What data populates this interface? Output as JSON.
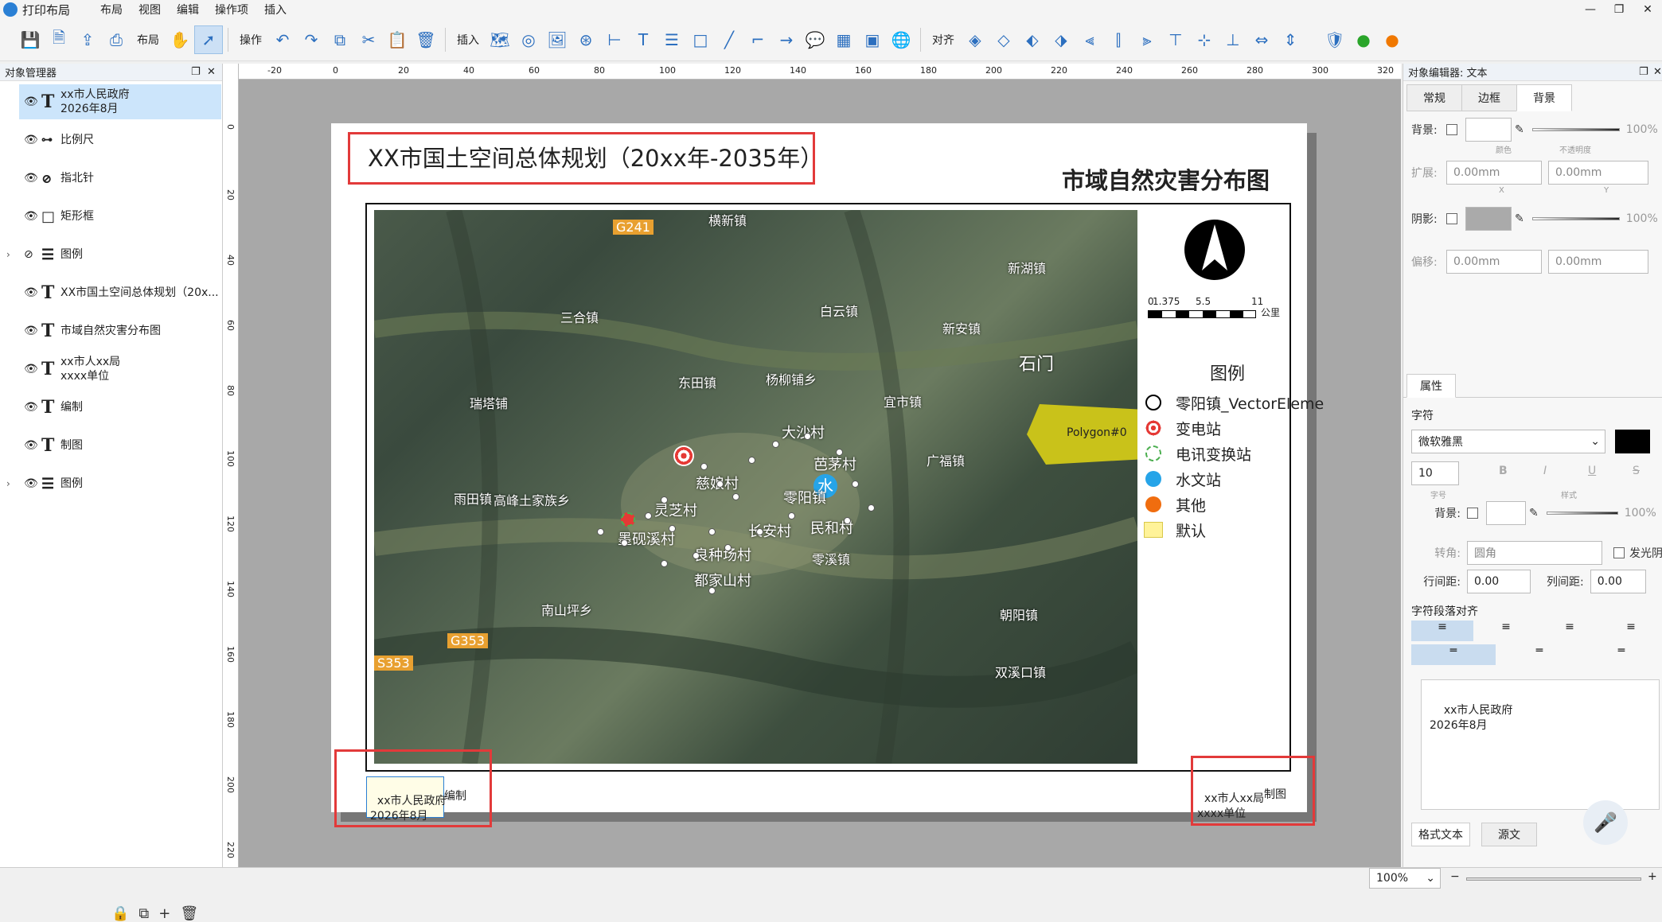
{
  "app": {
    "title": "打印布局",
    "menu": [
      "布局",
      "视图",
      "编辑",
      "操作项",
      "插入"
    ],
    "window_controls": [
      "—",
      "❐",
      "✕"
    ]
  },
  "toolbar": {
    "layout_label": "布局",
    "operate_label": "操作",
    "insert_label": "插入",
    "align_label": "对齐"
  },
  "object_manager": {
    "title": "对象管理器",
    "items": [
      {
        "icon": "text-icon",
        "label": "xx市人民政府\n2026年8月",
        "selected": true
      },
      {
        "icon": "scale-bar-icon",
        "label": "比例尺"
      },
      {
        "icon": "compass-icon",
        "label": "指北针"
      },
      {
        "icon": "rectangle-icon",
        "label": "矩形框"
      },
      {
        "icon": "legend-icon",
        "label": "图例",
        "expandable": true,
        "hidden": true
      },
      {
        "icon": "text-icon",
        "label": "XX市国土空间总体规划（20x..."
      },
      {
        "icon": "text-icon",
        "label": "市域自然灾害分布图"
      },
      {
        "icon": "text-icon",
        "label": "xx市人xx局\nxxxx单位"
      },
      {
        "icon": "text-icon",
        "label": "编制"
      },
      {
        "icon": "text-icon",
        "label": "制图"
      },
      {
        "icon": "legend-icon",
        "label": "图例",
        "expandable": true
      }
    ]
  },
  "ruler": {
    "h_ticks": [
      "-20",
      "0",
      "20",
      "40",
      "60",
      "80",
      "100",
      "120",
      "140",
      "160",
      "180",
      "200",
      "220",
      "240",
      "260",
      "280",
      "300",
      "320"
    ],
    "v_ticks": [
      "0",
      "20",
      "40",
      "60",
      "80",
      "100",
      "120",
      "140",
      "160",
      "180",
      "200",
      "220"
    ]
  },
  "layout_page": {
    "main_title": "XX市国土空间总体规划（20xx年-2035年）",
    "subtitle": "市域自然灾害分布图",
    "scale_labels": [
      "0",
      "1.375",
      "5.5",
      "11",
      "公里"
    ],
    "legend": {
      "title": "图例",
      "items": [
        {
          "symbol": "circle-outline",
          "label": "零阳镇_VectorEleme"
        },
        {
          "symbol": "target",
          "label": "变电站"
        },
        {
          "symbol": "telecom",
          "label": "电讯变换站"
        },
        {
          "symbol": "water",
          "label": "水文站"
        },
        {
          "symbol": "orange-dot",
          "label": "其他"
        },
        {
          "symbol": "yellow-rect",
          "label": "默认"
        }
      ]
    },
    "footer_left": "xx市人民政府\n2026年8月",
    "footer_left_tail": "编制",
    "footer_right": "xx市人xx局\nxxxx单位",
    "footer_right_tail": "制图",
    "map_labels": [
      "G241",
      "横新镇",
      "三合镇",
      "白云镇",
      "新湖镇",
      "新安镇",
      "石门",
      "东田镇",
      "杨柳铺乡",
      "大沙村",
      "芭茅村",
      "广福镇",
      "水",
      "零阳镇",
      "灵芝村",
      "墨砚溪村",
      "良种场村",
      "都家山村",
      "雨田镇",
      "G353",
      "S353",
      "南山坪乡",
      "零溪镇",
      "双溪口镇",
      "Polygon#0",
      "宜市镇",
      "长安村",
      "民和村",
      "慈娘村",
      "高峰土家族乡",
      "瑞塔铺",
      "朝阳镇"
    ]
  },
  "object_editor": {
    "title": "对象编辑器: 文本",
    "tabs": [
      "常规",
      "边框",
      "背景"
    ],
    "active_tab": "背景",
    "background_label": "背景:",
    "background_opacity": "100%",
    "color_caption": "颜色",
    "opacity_caption": "不透明度",
    "expand_label": "扩展:",
    "expand_x": "0.00mm",
    "expand_y": "0.00mm",
    "shadow_label": "阴影:",
    "shadow_opacity": "100%",
    "offset_label": "偏移:",
    "offset_x": "0.00mm",
    "offset_y": "0.00mm",
    "axis_x": "X",
    "axis_y": "Y"
  },
  "properties": {
    "tab": "属性",
    "char_label": "字符",
    "font": "微软雅黑",
    "size": "10",
    "size_caption": "字号",
    "style_caption": "样式",
    "bg_label": "背景:",
    "bg_opacity": "100%",
    "corner_label": "转角:",
    "corner_value": "圆角",
    "glow_label": "发光阴影",
    "line_spacing_label": "行间距:",
    "line_spacing": "0.00",
    "col_spacing_label": "列间距:",
    "col_spacing": "0.00",
    "align_label": "字符段落对齐",
    "text_content": "xx市人民政府\n2026年8月",
    "rich_text_tab": "格式文本",
    "source_tab": "源文"
  },
  "status": {
    "zoom": "100%"
  },
  "colors": {
    "accent": "#2c6fbf",
    "highlight_red": "#e23a3a",
    "polygon_yellow": "#c9c21a",
    "selection_blue": "#cce5fb"
  }
}
